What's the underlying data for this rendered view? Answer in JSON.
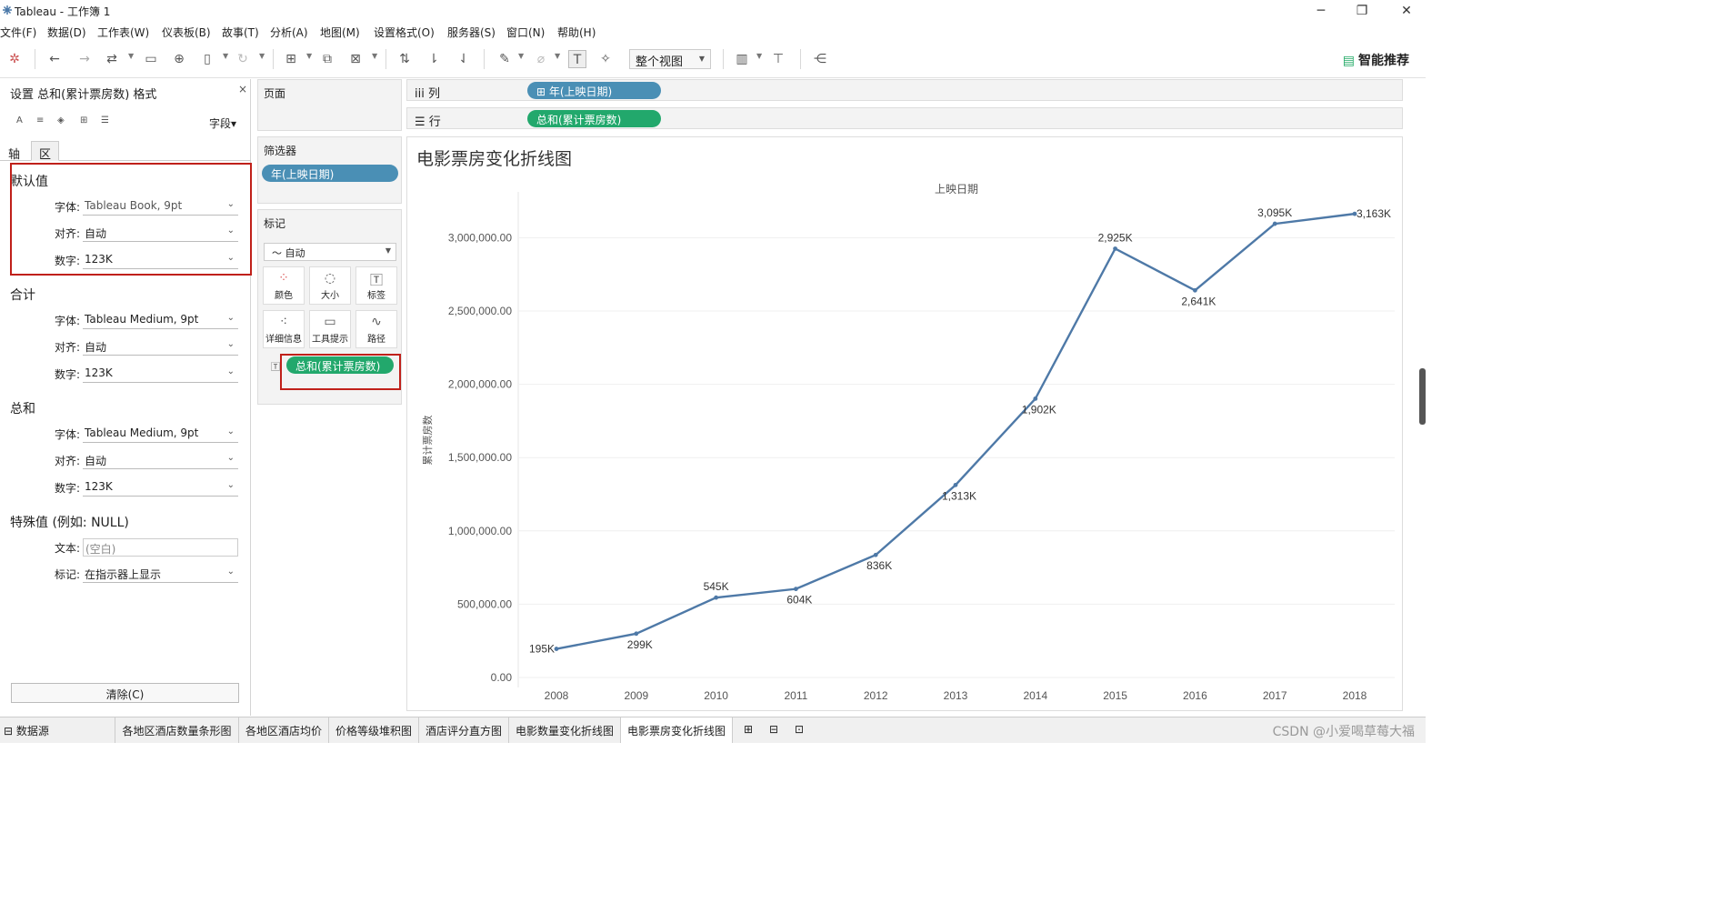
{
  "window": {
    "title": "Tableau - 工作簿 1"
  },
  "menu": [
    "文件(F)",
    "数据(D)",
    "工作表(W)",
    "仪表板(B)",
    "故事(T)",
    "分析(A)",
    "地图(M)",
    "设置格式(O)",
    "服务器(S)",
    "窗口(N)",
    "帮助(H)"
  ],
  "toolbar": {
    "view_mode": "整个视图",
    "smart": "智能推荐"
  },
  "format_pane": {
    "title": "设置 总和(累计票房数) 格式",
    "close": "×",
    "field_select": "字段▾",
    "tabs": [
      "轴",
      "区"
    ],
    "sections": [
      {
        "heading": "默认值",
        "rows": [
          {
            "label": "字体:",
            "value": "Tableau Book, 9pt"
          },
          {
            "label": "对齐:",
            "value": "自动"
          },
          {
            "label": "数字:",
            "value": "123K"
          }
        ]
      },
      {
        "heading": "合计",
        "rows": [
          {
            "label": "字体:",
            "value": "Tableau Medium, 9pt"
          },
          {
            "label": "对齐:",
            "value": "自动"
          },
          {
            "label": "数字:",
            "value": "123K"
          }
        ]
      },
      {
        "heading": "总和",
        "rows": [
          {
            "label": "字体:",
            "value": "Tableau Medium, 9pt"
          },
          {
            "label": "对齐:",
            "value": "自动"
          },
          {
            "label": "数字:",
            "value": "123K"
          }
        ]
      }
    ],
    "special": {
      "heading": "特殊值 (例如: NULL)",
      "text_label": "文本:",
      "text_placeholder": "(空白)",
      "mark_label": "标记:",
      "mark_value": "在指示器上显示"
    },
    "clear_button": "清除(C)"
  },
  "pages_card": {
    "title": "页面"
  },
  "filters_card": {
    "title": "筛选器",
    "pill": "年(上映日期)"
  },
  "marks_card": {
    "title": "标记",
    "type": "自动",
    "buttons": [
      "颜色",
      "大小",
      "标签",
      "详细信息",
      "工具提示",
      "路径"
    ],
    "pill": "总和(累计票房数)"
  },
  "columns_shelf": {
    "label": "iii 列",
    "pill": "⊞ 年(上映日期)"
  },
  "rows_shelf": {
    "label": "☰ 行",
    "pill": "总和(累计票房数)"
  },
  "chart_data": {
    "type": "line",
    "title": "电影票房变化折线图",
    "xlabel": "上映日期",
    "ylabel": "累计票房数",
    "x": [
      "2008",
      "2009",
      "2010",
      "2011",
      "2012",
      "2013",
      "2014",
      "2015",
      "2016",
      "2017",
      "2018"
    ],
    "series": [
      {
        "values": [
          195000,
          299000,
          545000,
          604000,
          836000,
          1313000,
          1902000,
          2925000,
          2641000,
          3095000,
          3163000
        ],
        "labels": [
          "195K",
          "299K",
          "545K",
          "604K",
          "836K",
          "1,313K",
          "1,902K",
          "2,925K",
          "2,641K",
          "3,095K",
          "3,163K"
        ],
        "color": "#4e79a7"
      }
    ],
    "ylim": [
      0,
      3000000
    ],
    "yticks": [
      "0.00",
      "500,000.00",
      "1,000,000.00",
      "1,500,000.00",
      "2,000,000.00",
      "2,500,000.00",
      "3,000,000.00"
    ],
    "grid": true
  },
  "bottom_tabs": {
    "datasource": "⊟ 数据源",
    "sheets": [
      "各地区酒店数量条形图",
      "各地区酒店均价",
      "价格等级堆积图",
      "酒店评分直方图",
      "电影数量变化折线图",
      "电影票房变化折线图"
    ],
    "active": "电影票房变化折线图",
    "watermark": "CSDN @小爱喝草莓大福"
  }
}
